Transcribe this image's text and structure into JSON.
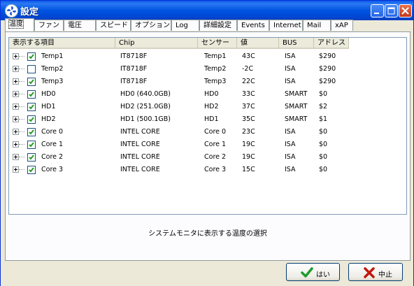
{
  "window": {
    "title": "設定"
  },
  "tabs": [
    {
      "label": "温度",
      "active": true
    },
    {
      "label": "ファン"
    },
    {
      "label": "電圧"
    },
    {
      "label": "スピード"
    },
    {
      "label": "オプション"
    },
    {
      "label": "Log"
    },
    {
      "label": "詳細設定"
    },
    {
      "label": "Events"
    },
    {
      "label": "Internet"
    },
    {
      "label": "Mail"
    },
    {
      "label": "xAP"
    }
  ],
  "table": {
    "columns": [
      "表示する項目",
      "Chip",
      "センサー",
      "値",
      "BUS",
      "アドレス"
    ],
    "rows": [
      {
        "item": "Temp1",
        "checked": true,
        "chip": "IT8718F",
        "sensor": "Temp1",
        "value": "43C",
        "bus": "ISA",
        "address": "$290"
      },
      {
        "item": "Temp2",
        "checked": false,
        "chip": "IT8718F",
        "sensor": "Temp2",
        "value": "-2C",
        "bus": "ISA",
        "address": "$290"
      },
      {
        "item": "Temp3",
        "checked": true,
        "chip": "IT8718F",
        "sensor": "Temp3",
        "value": "22C",
        "bus": "ISA",
        "address": "$290"
      },
      {
        "item": "HD0",
        "checked": true,
        "chip": "HD0 (640.0GB)",
        "sensor": "HD0",
        "value": "33C",
        "bus": "SMART",
        "address": "$0"
      },
      {
        "item": "HD1",
        "checked": true,
        "chip": "HD2 (251.0GB)",
        "sensor": "HD2",
        "value": "37C",
        "bus": "SMART",
        "address": "$2"
      },
      {
        "item": "HD2",
        "checked": true,
        "chip": "HD1 (500.1GB)",
        "sensor": "HD1",
        "value": "35C",
        "bus": "SMART",
        "address": "$1"
      },
      {
        "item": "Core 0",
        "checked": true,
        "chip": "INTEL CORE",
        "sensor": "Core 0",
        "value": "23C",
        "bus": "ISA",
        "address": "$0"
      },
      {
        "item": "Core 1",
        "checked": true,
        "chip": "INTEL CORE",
        "sensor": "Core 1",
        "value": "19C",
        "bus": "ISA",
        "address": "$0"
      },
      {
        "item": "Core 2",
        "checked": true,
        "chip": "INTEL CORE",
        "sensor": "Core 2",
        "value": "19C",
        "bus": "ISA",
        "address": "$0"
      },
      {
        "item": "Core 3",
        "checked": true,
        "chip": "INTEL CORE",
        "sensor": "Core 3",
        "value": "15C",
        "bus": "ISA",
        "address": "$0"
      }
    ]
  },
  "description": "システムモニタに表示する温度の選択",
  "buttons": {
    "ok_label": "はい",
    "cancel_label": "中止"
  },
  "colors": {
    "titlebar": "#0053e1",
    "ok_check": "#1e9c2a",
    "cancel_x": "#c0180c"
  }
}
